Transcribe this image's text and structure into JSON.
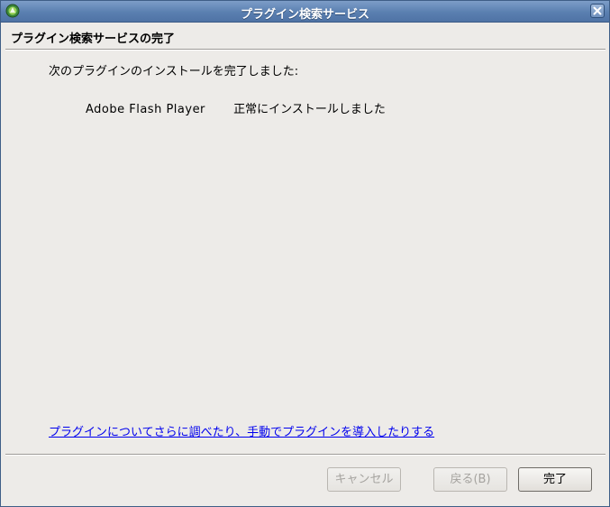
{
  "window": {
    "title": "プラグイン検索サービス"
  },
  "header": {
    "title": "プラグイン検索サービスの完了"
  },
  "content": {
    "intro": "次のプラグインのインストールを完了しました:",
    "plugins": [
      {
        "name": "Adobe Flash Player",
        "status": "正常にインストールしました"
      }
    ],
    "help_link": "プラグインについてさらに調べたり、手動でプラグインを導入したりする"
  },
  "buttons": {
    "cancel": "キャンセル",
    "back": "戻る(B)",
    "finish": "完了"
  },
  "colors": {
    "titlebar": "#5a7fb0",
    "background": "#edebe8",
    "link": "#0000ee"
  },
  "icons": {
    "app": "app-icon",
    "close": "close-icon"
  }
}
